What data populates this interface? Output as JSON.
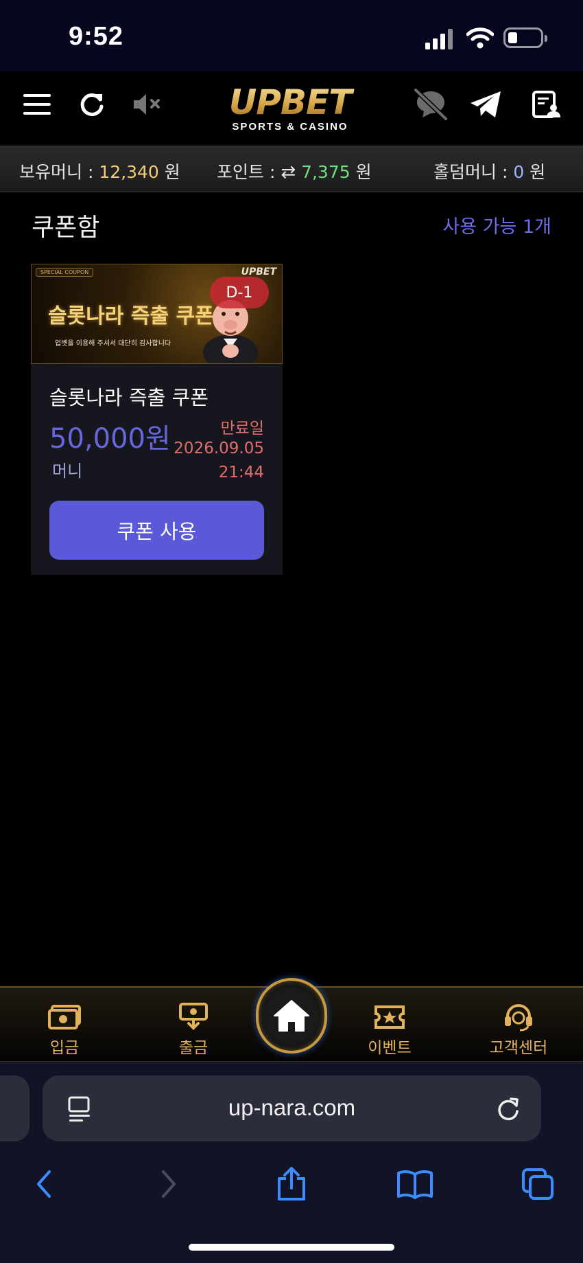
{
  "status_bar": {
    "time": "9:52"
  },
  "header": {
    "logo_text": "UPBET",
    "logo_tagline": "SPORTS & CASINO",
    "icons": [
      "menu-icon",
      "refresh-icon",
      "mute-icon",
      "chat-off-icon",
      "telegram-icon",
      "profile-icon"
    ]
  },
  "balance": {
    "money_label": "보유머니 :",
    "money_value": "12,340",
    "money_unit": "원",
    "point_label": "포인트 :",
    "point_value": "7,375",
    "point_unit": "원",
    "hold_label": "홀덤머니 :",
    "hold_value": "0",
    "hold_unit": "원"
  },
  "coupon_section": {
    "title": "쿠폰함",
    "available": "사용 가능 1개"
  },
  "coupon": {
    "banner_badge": "SPECIAL COUPON",
    "banner_logo": "UPBET",
    "banner_title": "슬롯나라 즉출 쿠폰",
    "banner_subtitle": "업벳을 이용해 주셔서 대단히 감사합니다",
    "d_day": "D-1",
    "name": "슬롯나라 즉출 쿠폰",
    "amount": "50,000원",
    "type": "머니",
    "expiry_label": "만료일",
    "expiry_date": "2026.09.05",
    "expiry_time": "21:44",
    "use_button": "쿠폰 사용"
  },
  "bottom_nav": {
    "deposit": "입금",
    "withdraw": "출금",
    "event": "이벤트",
    "support": "고객센터"
  },
  "safari": {
    "url": "up-nara.com"
  },
  "colors": {
    "accent": "#5a5ad8",
    "gold": "#e1b15d",
    "expiry": "#e36e6e",
    "points_green": "#6fe07c"
  }
}
